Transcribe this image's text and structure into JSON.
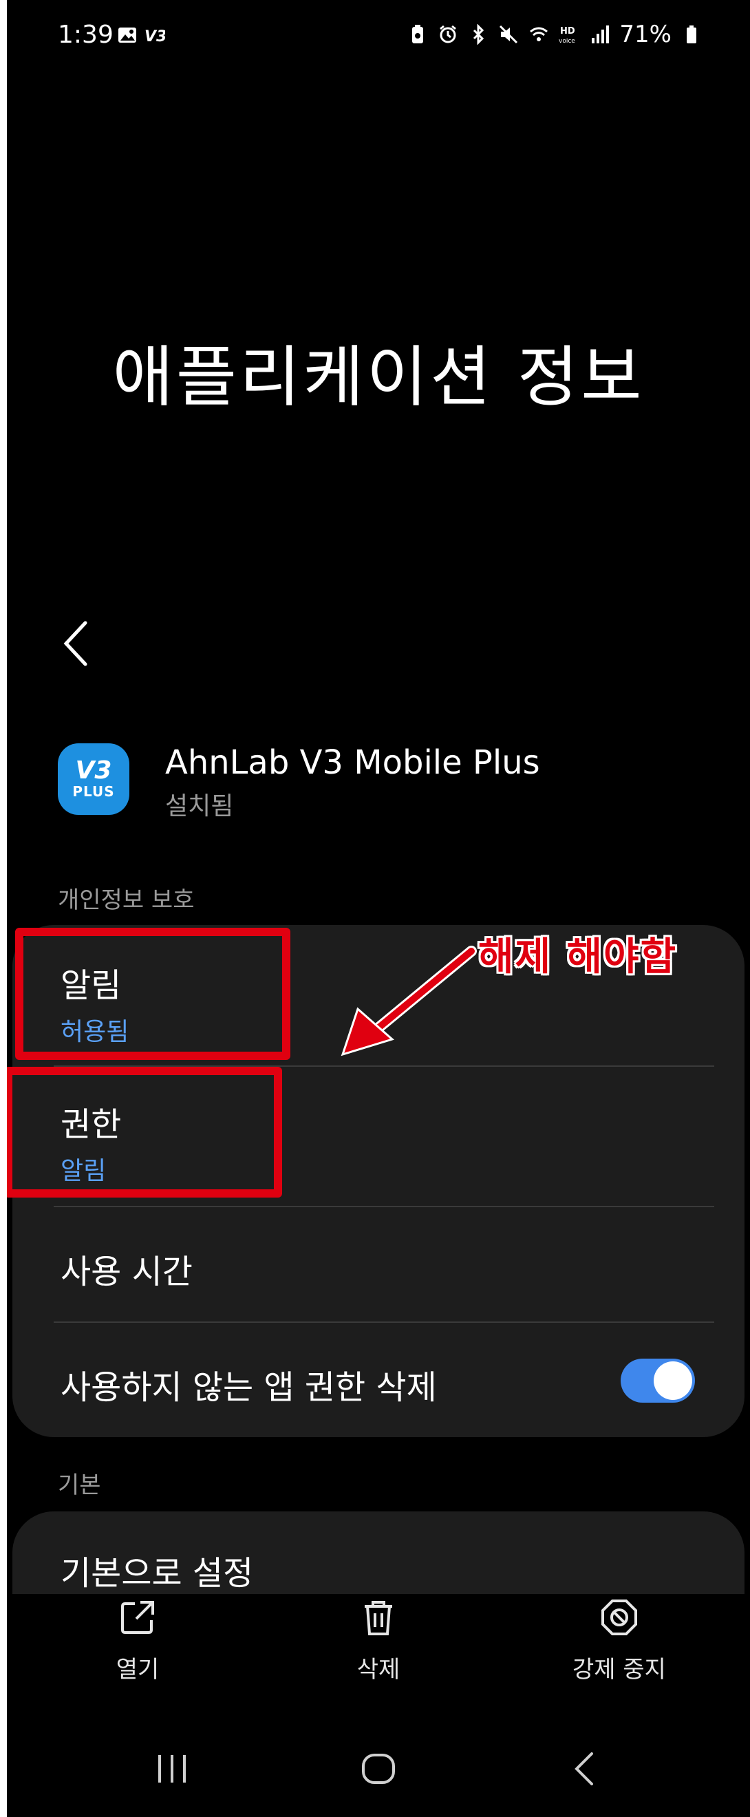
{
  "status_bar": {
    "time": "1:39",
    "battery_text": "71%",
    "left_icons": [
      "gallery-icon",
      "v3-notification-icon"
    ],
    "right_icons": [
      "battery-saver-icon",
      "alarm-icon",
      "bluetooth-icon",
      "mute-icon",
      "wifi-icon",
      "hd-voice-icon",
      "signal-icon",
      "battery-icon"
    ]
  },
  "page": {
    "title": "애플리케이션 정보"
  },
  "app": {
    "name": "AhnLab V3 Mobile Plus",
    "status": "설치됨",
    "icon_text": "V3",
    "icon_sub": "PLUS"
  },
  "privacy_section": {
    "label": "개인정보 보호",
    "items": [
      {
        "title": "알림",
        "subtitle": "허용됨"
      },
      {
        "title": "권한",
        "subtitle": "알림"
      },
      {
        "title": "사용 시간"
      },
      {
        "title": "사용하지 않는 앱 권한 삭제",
        "toggle_on": true
      }
    ]
  },
  "default_section": {
    "label": "기본",
    "items": [
      {
        "title": "기본으로 설정"
      }
    ]
  },
  "annotation": {
    "text": "해제 해야함",
    "color": "#e00010"
  },
  "bottom_actions": [
    {
      "label": "열기",
      "icon": "open-external-icon"
    },
    {
      "label": "삭제",
      "icon": "trash-icon"
    },
    {
      "label": "강제 중지",
      "icon": "force-stop-icon"
    }
  ],
  "colors": {
    "accent_blue": "#5aa0f5",
    "toggle_on": "#3f87ec",
    "card_bg": "#1d1d1d"
  }
}
